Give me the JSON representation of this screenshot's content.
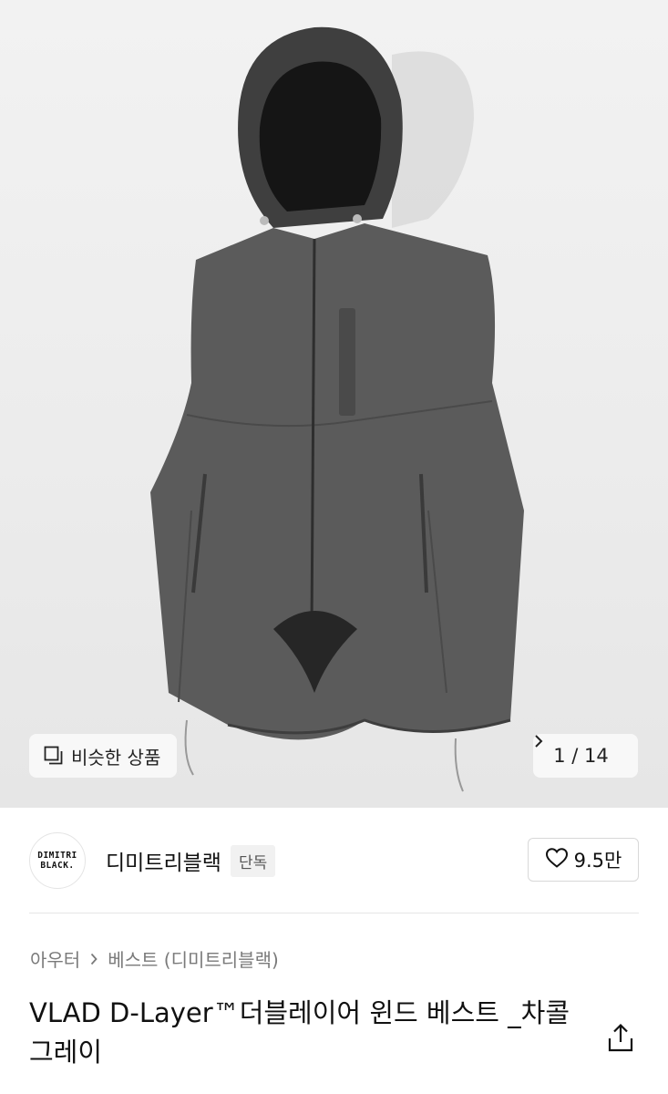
{
  "gallery": {
    "similar_label": "비슷한 상품",
    "current_page": "1",
    "separator": "/",
    "total_pages": "14",
    "icons": [
      "similar-products-icon",
      "chevron-right-icon"
    ]
  },
  "brand": {
    "logo_line1": "DIMITRI",
    "logo_line2": "BLACK.",
    "name": "디미트리블랙",
    "tag": "단독"
  },
  "like": {
    "count": "9.5만",
    "icon": "heart-outline-icon"
  },
  "breadcrumb": {
    "category": "아우터",
    "subcategory": "베스트 (디미트리블랙)"
  },
  "product": {
    "title": "VLAD D-Layer™더블레이어 윈드 베스트 _차콜 그레이",
    "share_icon": "share-icon"
  },
  "colors": {
    "background": "#ffffff",
    "hero_background": "#eeeeee",
    "vest": "#5b5b5b",
    "text_primary": "#111111",
    "text_secondary": "#7a7a7a"
  }
}
